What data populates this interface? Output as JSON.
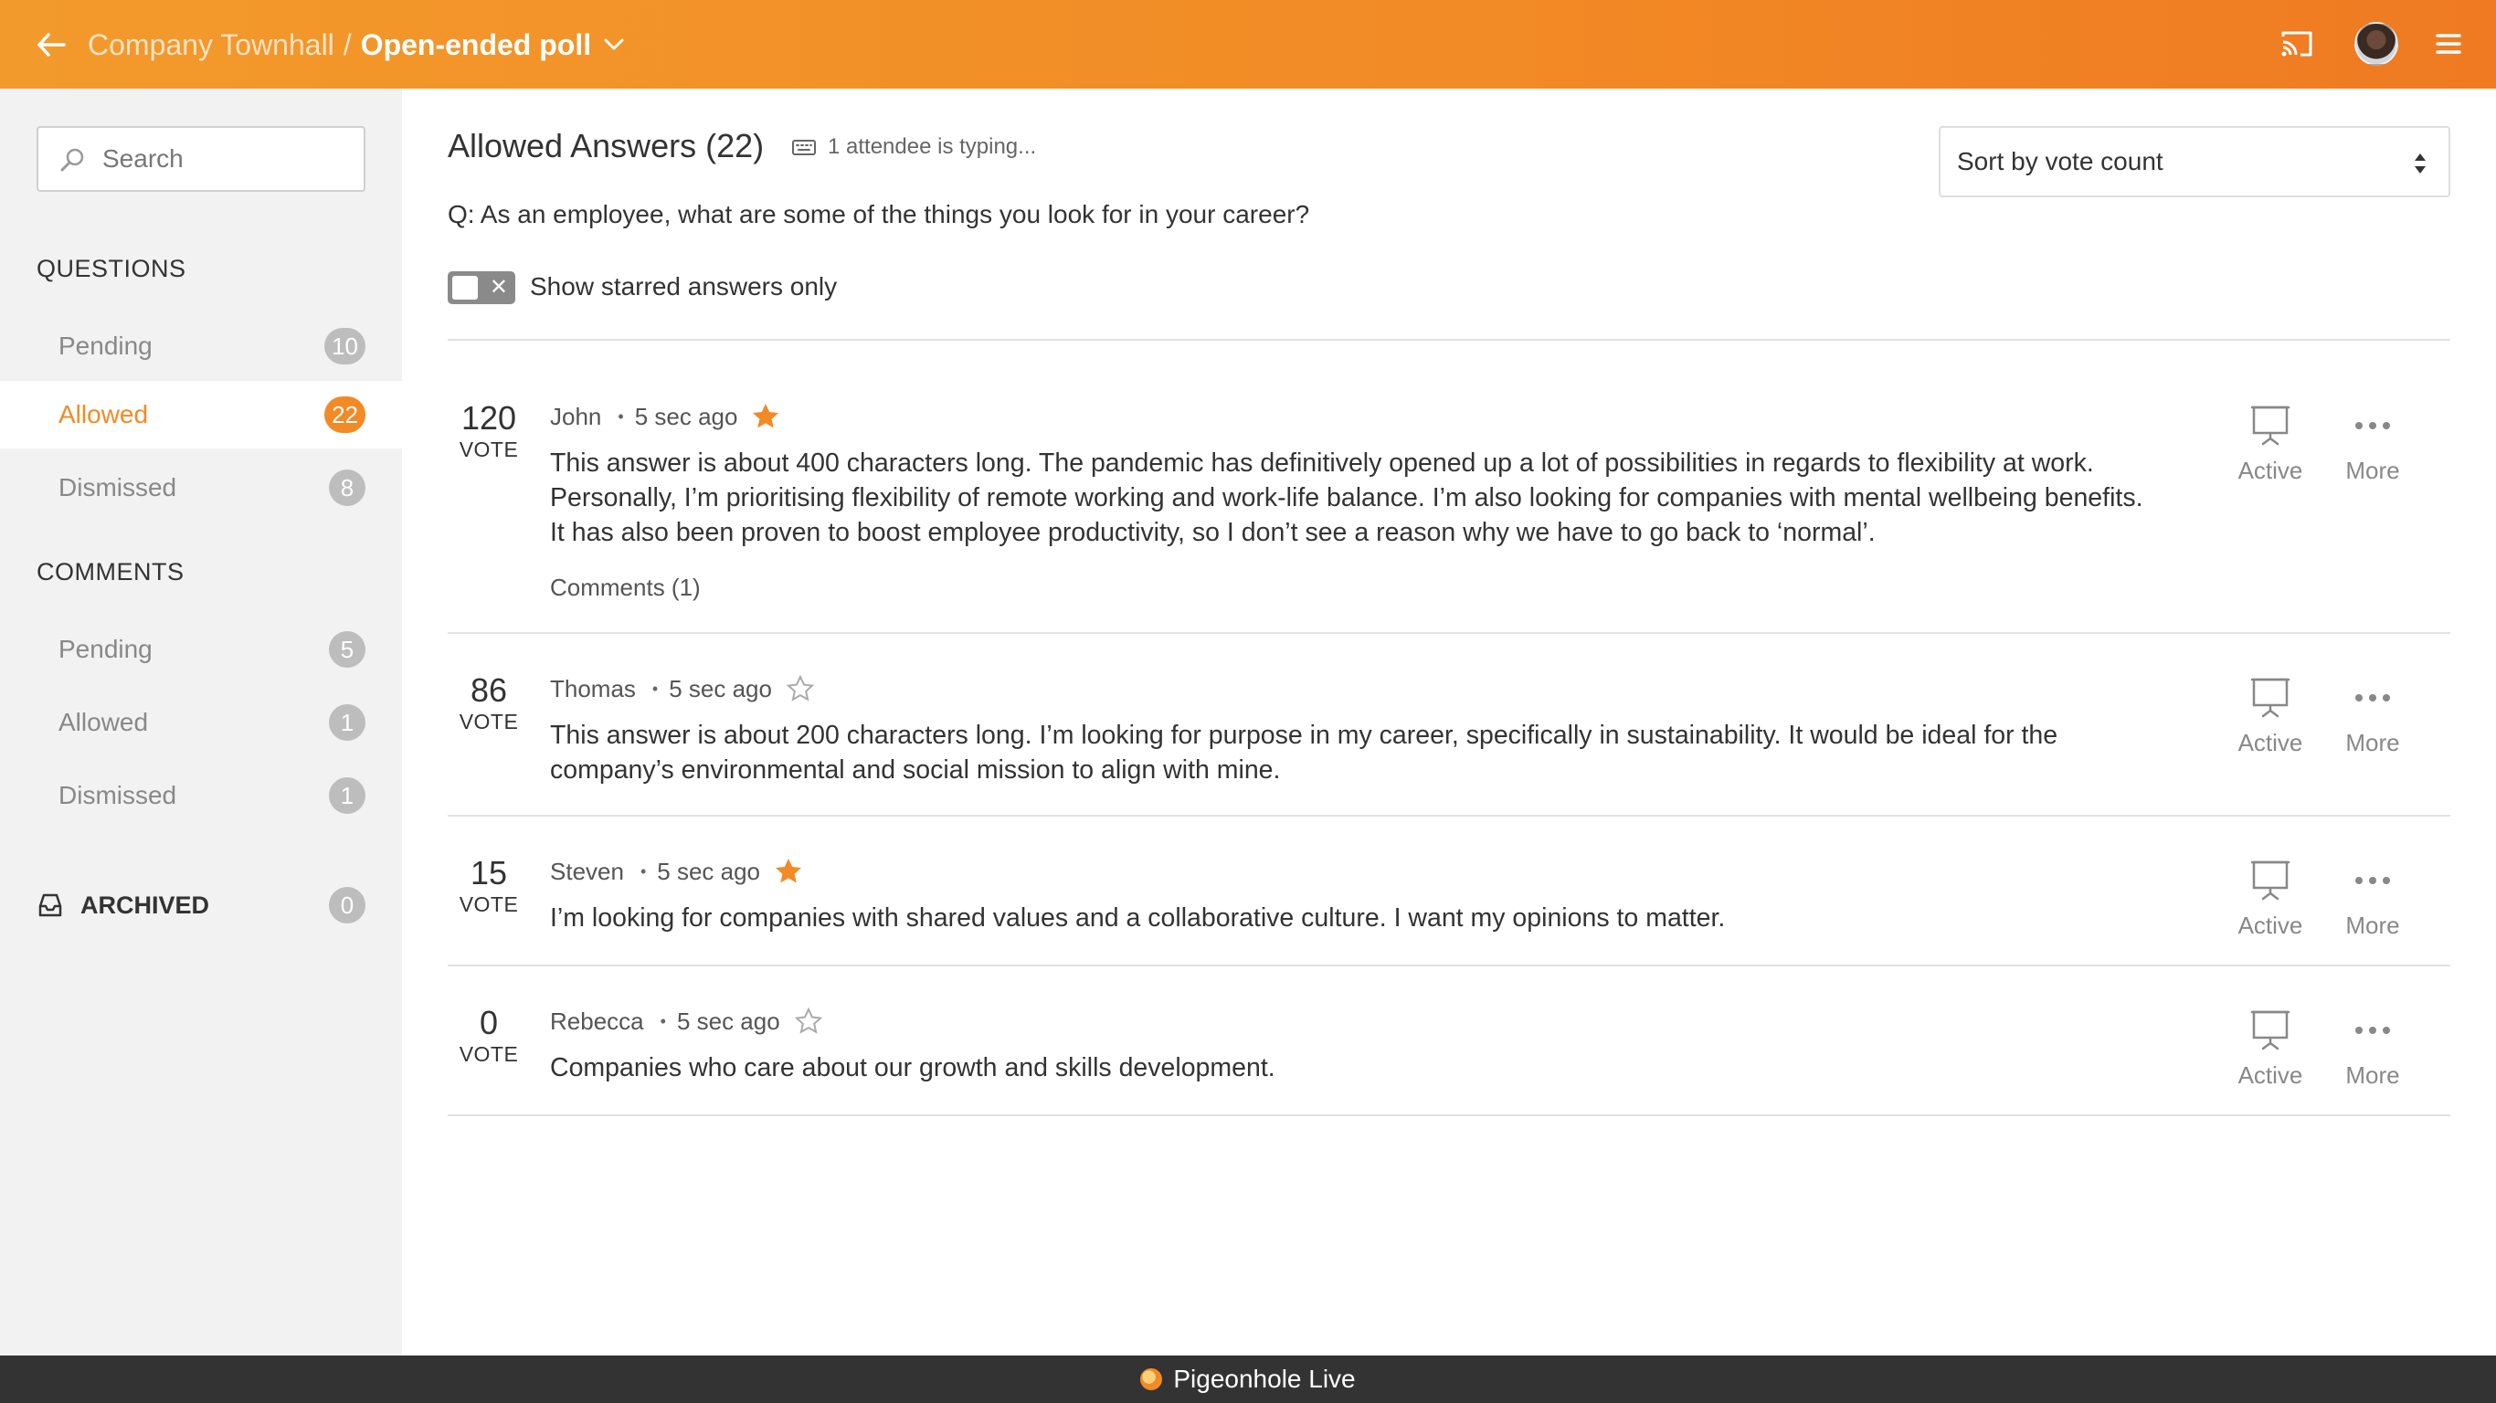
{
  "header": {
    "breadcrumb_parent": "Company Townhall",
    "breadcrumb_separator": "/",
    "breadcrumb_current": "Open-ended poll",
    "accent_color": "#f28a25"
  },
  "sidebar": {
    "search_placeholder": "Search",
    "questions_title": "QUESTIONS",
    "questions": [
      {
        "label": "Pending",
        "count": "10"
      },
      {
        "label": "Allowed",
        "count": "22"
      },
      {
        "label": "Dismissed",
        "count": "8"
      }
    ],
    "comments_title": "COMMENTS",
    "comments": [
      {
        "label": "Pending",
        "count": "5"
      },
      {
        "label": "Allowed",
        "count": "1"
      },
      {
        "label": "Dismissed",
        "count": "1"
      }
    ],
    "archived_label": "ARCHIVED",
    "archived_count": "0"
  },
  "main": {
    "heading": "Allowed Answers (22)",
    "typing_status": "1 attendee is typing...",
    "sort_selected": "Sort by vote count",
    "question": "Q: As an employee, what are some of the things you look for in your career?",
    "toggle_label": "Show starred answers only",
    "vote_label": "VOTE",
    "active_label": "Active",
    "more_label": "More",
    "answers": [
      {
        "votes": "120",
        "author": "John",
        "time": "5 sec ago",
        "starred": true,
        "lines": [
          "This answer is about 400 characters long. The pandemic has definitively opened up a lot of possibilities in regards to flexibility at work.",
          "Personally, I’m prioritising flexibility of remote working and work-life balance. I’m also looking for companies with mental wellbeing benefits.",
          "It has also been proven to boost employee productivity, so I don’t see a reason why we have to go back to ‘normal’."
        ],
        "comments": "Comments (1)"
      },
      {
        "votes": "86",
        "author": "Thomas",
        "time": "5 sec ago",
        "starred": false,
        "lines": [
          "This answer is about 200 characters long. I’m looking for purpose in my career, specifically in sustainability. It would be ideal for the",
          "company’s environmental and social mission to align with mine."
        ]
      },
      {
        "votes": "15",
        "author": "Steven",
        "time": "5 sec ago",
        "starred": true,
        "lines": [
          "I’m looking for companies with shared values and a collaborative culture. I want my opinions to matter."
        ]
      },
      {
        "votes": "0",
        "author": "Rebecca",
        "time": "5 sec ago",
        "starred": false,
        "lines": [
          "Companies who care about our growth and skills development."
        ]
      }
    ]
  },
  "footer": {
    "brand": "Pigeonhole Live"
  }
}
